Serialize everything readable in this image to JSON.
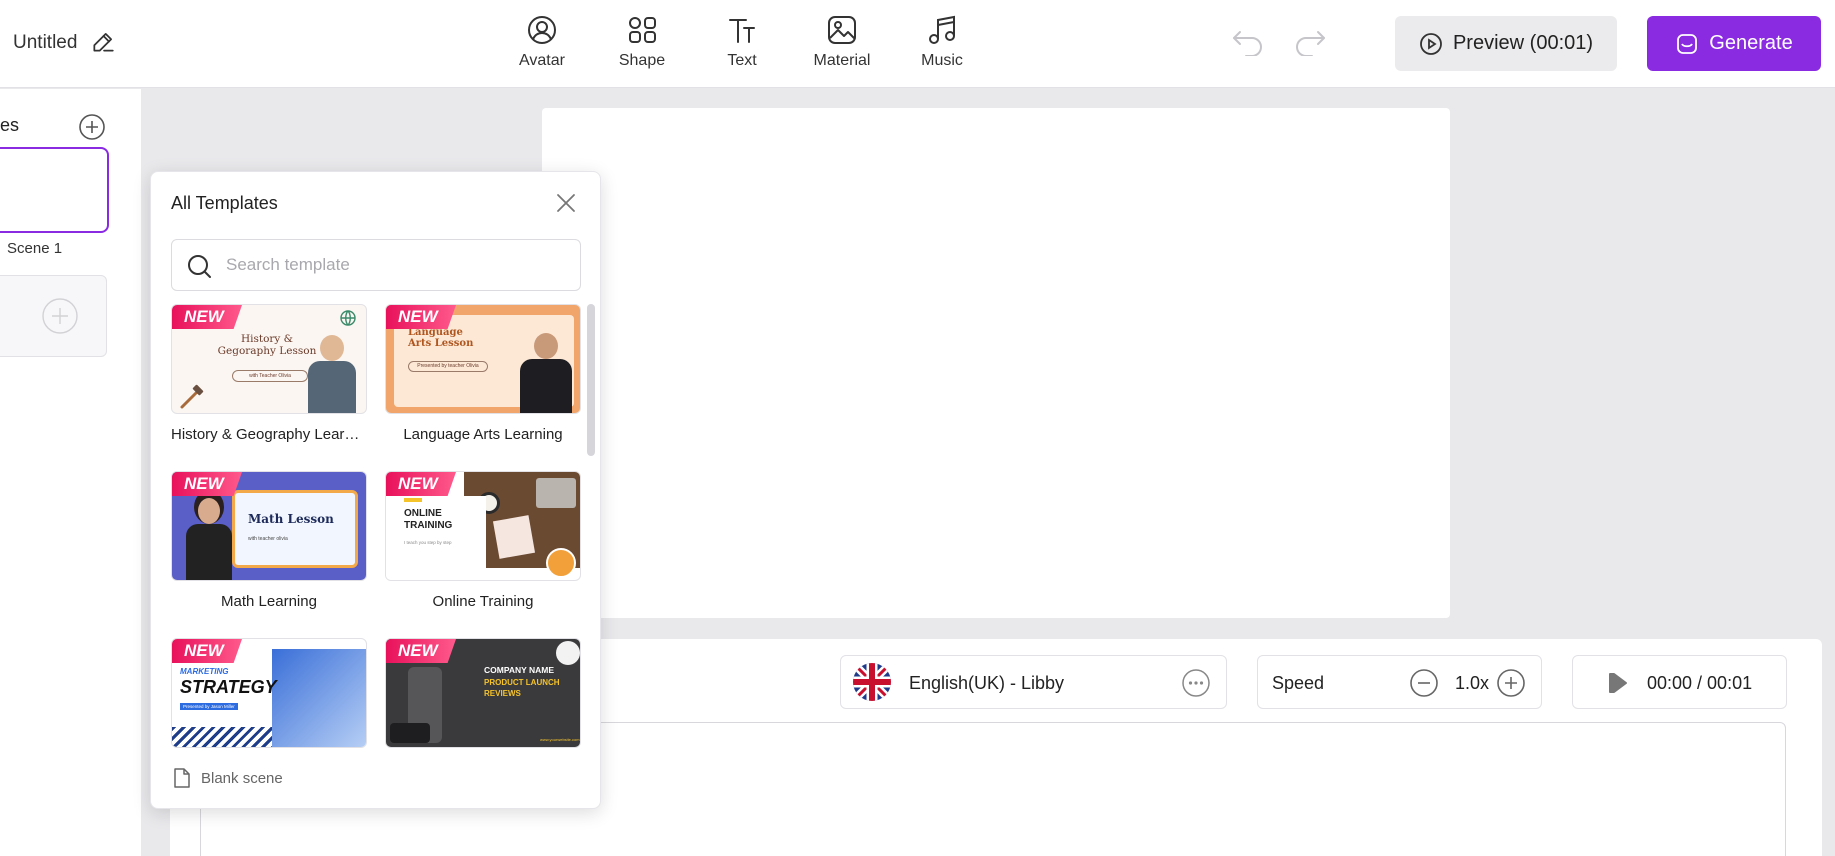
{
  "header": {
    "title": "Untitled",
    "tools": [
      {
        "label": "Avatar",
        "icon": "avatar-icon"
      },
      {
        "label": "Shape",
        "icon": "shape-icon"
      },
      {
        "label": "Text",
        "icon": "text-icon"
      },
      {
        "label": "Material",
        "icon": "material-icon"
      },
      {
        "label": "Music",
        "icon": "music-icon"
      }
    ],
    "preview_label": "Preview (00:01)",
    "generate_label": "Generate"
  },
  "sidebar": {
    "title": "es",
    "scene_label": "Scene 1"
  },
  "templates": {
    "title": "All Templates",
    "search_placeholder": "Search template",
    "badge": "NEW",
    "items": [
      {
        "name": "History & Geography Learni...",
        "thumb_title": "History & Gegoraphy Lesson",
        "thumb_sub": "with Teacher Olivia"
      },
      {
        "name": "Language Arts Learning",
        "thumb_title": "Language Arts Lesson",
        "thumb_sub": "Presented by teacher Olivia"
      },
      {
        "name": "Math Learning",
        "thumb_title": "Math Lesson",
        "thumb_sub": "with teacher olivia"
      },
      {
        "name": "Online Training",
        "thumb_title": "ONLINE TRAINING",
        "thumb_sub": "I teach you step by step"
      },
      {
        "name": "",
        "thumb_title": "STRATEGY",
        "thumb_kicker": "MARKETING",
        "thumb_sub": "Presented by Jason Miller"
      },
      {
        "name": "",
        "thumb_title": "PRODUCT LAUNCH REVIEWS",
        "thumb_kicker": "COMPANY NAME",
        "thumb_sub": "www.yourwebsite.com"
      }
    ],
    "blank_label": "Blank scene"
  },
  "voice": {
    "label": "English(UK) - Libby"
  },
  "speed": {
    "label": "Speed",
    "value": "1.0x"
  },
  "player": {
    "time": "00:00 / 00:01"
  },
  "colors": {
    "accent": "#8a2be2",
    "badge": "#e8115b"
  }
}
